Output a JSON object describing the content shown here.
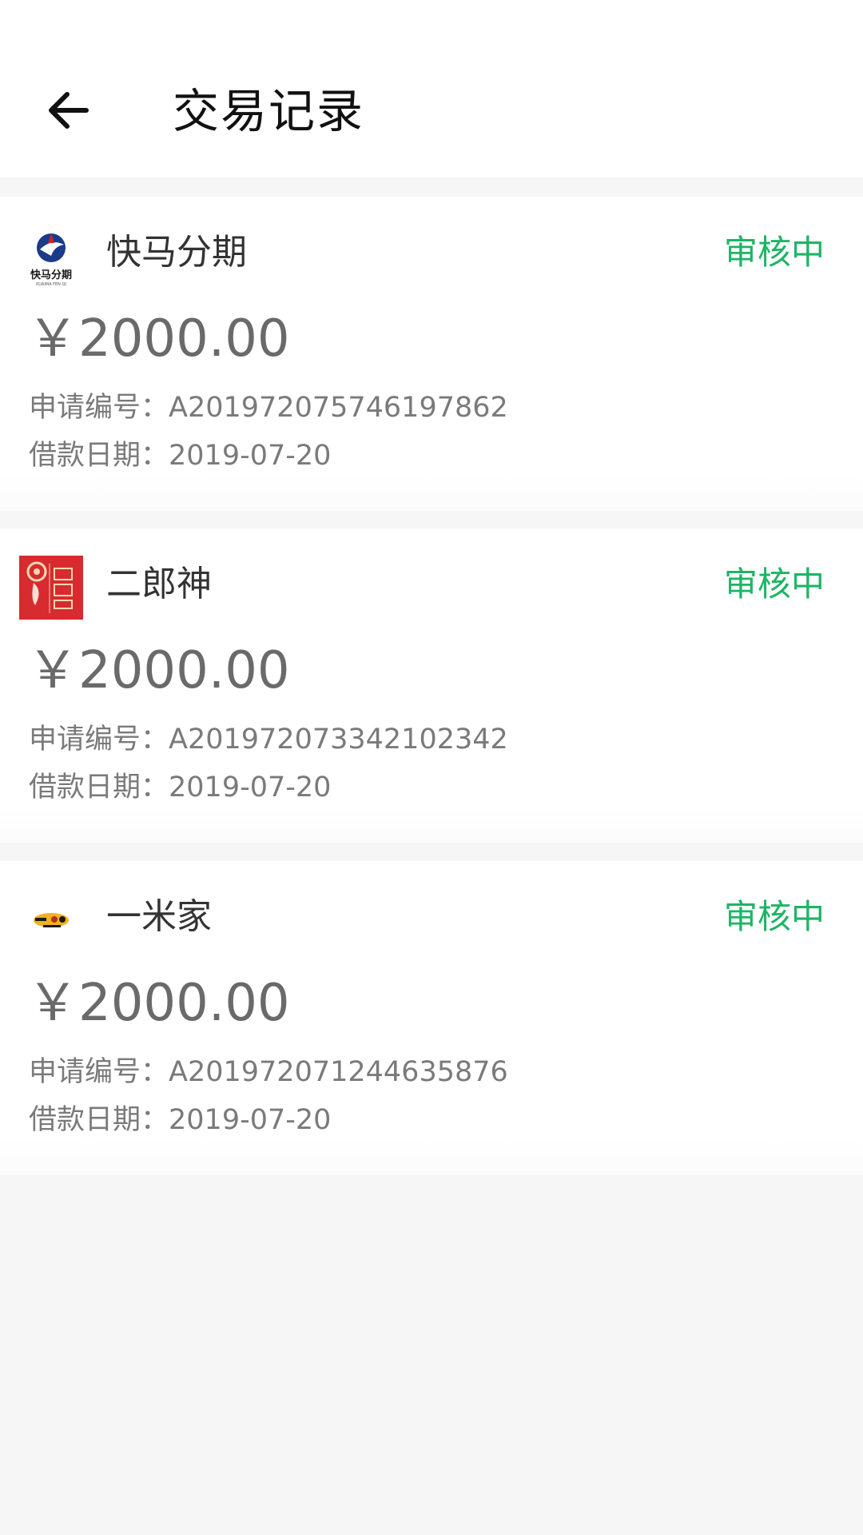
{
  "header": {
    "title": "交易记录"
  },
  "labels": {
    "application_no": "申请编号：",
    "loan_date": "借款日期："
  },
  "status_color": "#1fb466",
  "records": [
    {
      "merchant": "快马分期",
      "logo_text": "快马分期",
      "status": "审核中",
      "amount": "￥2000.00",
      "application_no": "A201972075746197862",
      "loan_date": "2019-07-20"
    },
    {
      "merchant": "二郎神",
      "logo_text": "",
      "status": "审核中",
      "amount": "￥2000.00",
      "application_no": "A201972073342102342",
      "loan_date": "2019-07-20"
    },
    {
      "merchant": "一米家",
      "logo_text": "",
      "status": "审核中",
      "amount": "￥2000.00",
      "application_no": "A201972071244635876",
      "loan_date": "2019-07-20"
    }
  ]
}
